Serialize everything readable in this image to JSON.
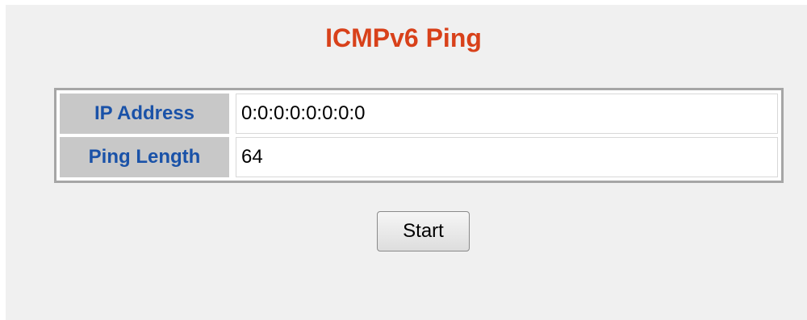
{
  "page": {
    "title": "ICMPv6 Ping"
  },
  "form": {
    "ip_address": {
      "label": "IP Address",
      "value": "0:0:0:0:0:0:0:0"
    },
    "ping_length": {
      "label": "Ping Length",
      "value": "64"
    }
  },
  "actions": {
    "start_label": "Start"
  },
  "colors": {
    "title": "#d8411a",
    "label_text": "#1a52a8",
    "label_background": "#c8c8c8",
    "panel_background": "#f0f0f0",
    "table_border": "#a6a6a6"
  }
}
